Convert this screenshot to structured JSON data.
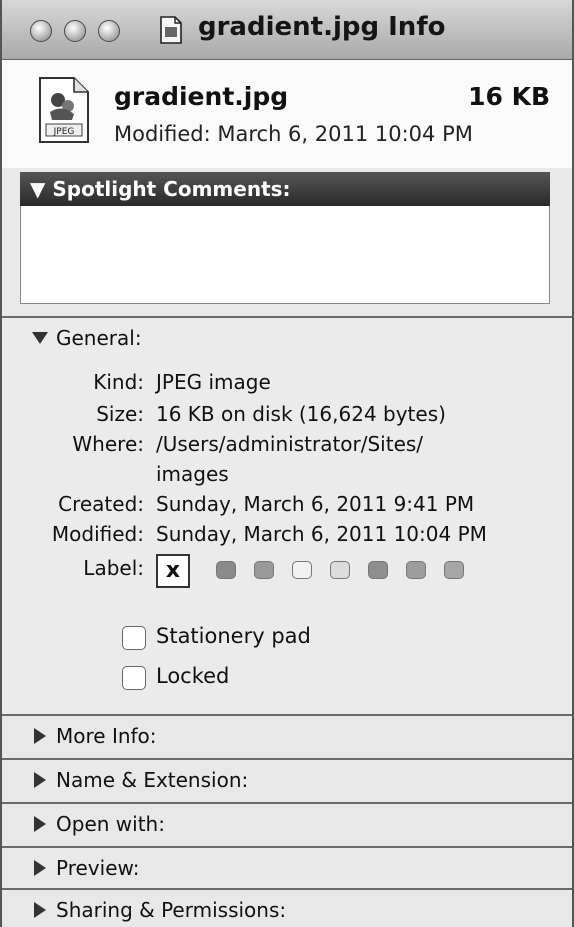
{
  "window": {
    "title": "gradient.jpg Info"
  },
  "header": {
    "file_name": "gradient.jpg",
    "file_size": "16 KB",
    "modified": "Modified: March 6, 2011 10:04 PM",
    "icon_text": "JPEG"
  },
  "spotlight": {
    "title": "Spotlight Comments:",
    "value": ""
  },
  "general": {
    "title": "General:",
    "rows": [
      {
        "label": "Kind:",
        "value": "JPEG image"
      },
      {
        "label": "Size:",
        "value": "16 KB on disk (16,624 bytes)"
      },
      {
        "label": "Where:",
        "value": "/Users/administrator/Sites/",
        "value2": "images"
      },
      {
        "label": "Created:",
        "value": "Sunday, March 6, 2011 9:41 PM"
      },
      {
        "label": "Modified:",
        "value": "Sunday, March 6, 2011 10:04 PM"
      },
      {
        "label": "Label:",
        "value": "x"
      }
    ],
    "label_swatch_colors": [
      "#8a8a8a",
      "#9a9a9a",
      "#f2f2f2",
      "#dcdcdc",
      "#8e8e8e",
      "#9d9d9d",
      "#a6a6a6"
    ],
    "stationery_label": "Stationery pad",
    "locked_label": "Locked"
  },
  "sections": [
    {
      "title": "More Info:"
    },
    {
      "title": "Name & Extension:"
    },
    {
      "title": "Open with:"
    },
    {
      "title": "Preview:"
    },
    {
      "title": "Sharing & Permissions:"
    }
  ]
}
